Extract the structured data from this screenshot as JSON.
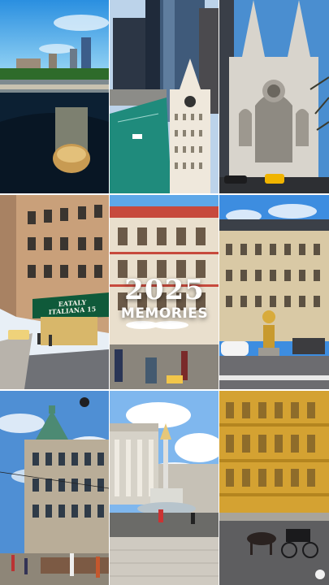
{
  "overlay": {
    "year": "2025",
    "caption": "MEMORIES"
  },
  "signs": {
    "storefront": "EATALY ITALIANA",
    "storefront_number": "15"
  },
  "photos": [
    {
      "name": "river-bridge-skyline"
    },
    {
      "name": "chicago-river-towers"
    },
    {
      "name": "gothic-cathedral"
    },
    {
      "name": "european-street"
    },
    {
      "name": "paris-buildings"
    },
    {
      "name": "square-with-statue"
    },
    {
      "name": "grand-department-store"
    },
    {
      "name": "palace-fountain"
    },
    {
      "name": "yellow-building-carriage"
    }
  ]
}
